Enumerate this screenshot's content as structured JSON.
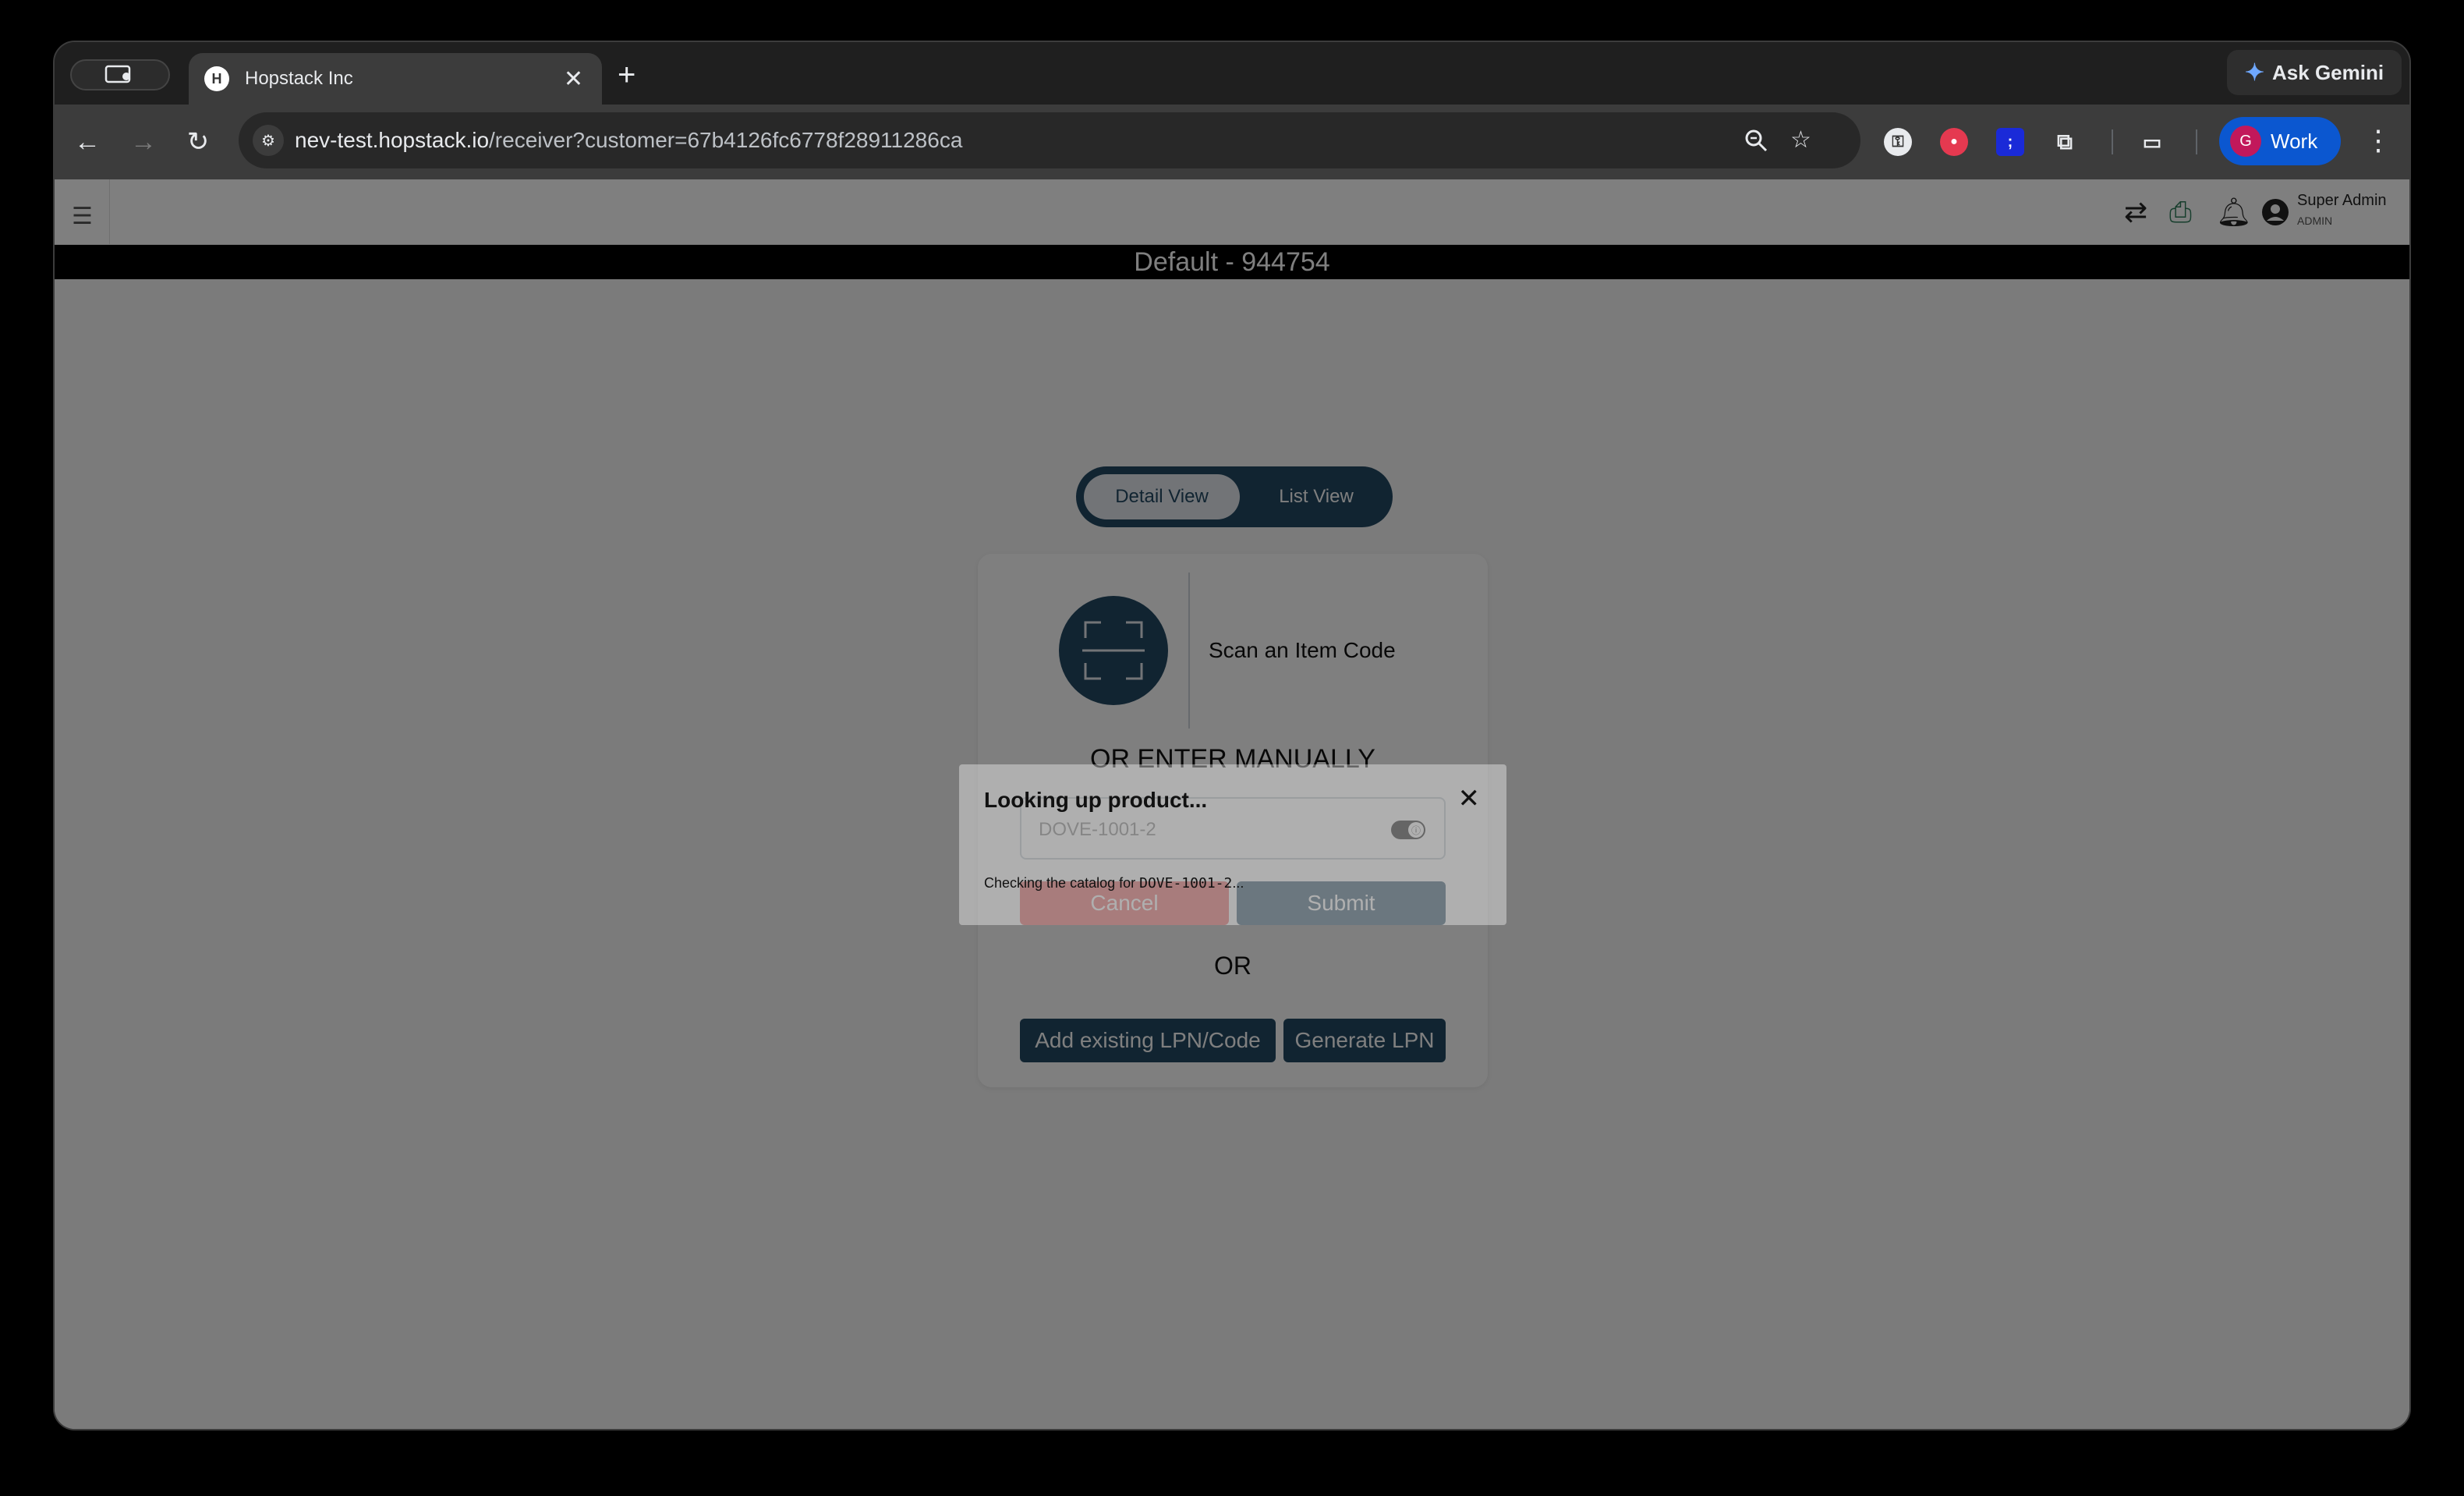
{
  "browser": {
    "tab": {
      "title": "Hopstack Inc",
      "favicon_letter": "H",
      "close_glyph": "✕"
    },
    "new_tab_glyph": "+",
    "ask_gemini_label": "Ask Gemini",
    "url_host": "nev-test.hopstack.io",
    "url_path": "/receiver?customer=67b4126fc6778f28911286ca",
    "profile": {
      "initial": "G",
      "label": "Work",
      "avatar_color": "#c2185b"
    },
    "icons": [
      "tab-search-icon",
      "back-icon",
      "forward-icon",
      "reload-icon",
      "site-info-icon",
      "zoom-icon",
      "bookmark-star-icon",
      "password-manager-icon",
      "extension-red-icon",
      "extension-blue-icon",
      "extensions-puzzle-icon",
      "tab-capture-icon",
      "menu-kebab-icon"
    ]
  },
  "app": {
    "user": {
      "name": "Super Admin",
      "role": "ADMIN"
    },
    "banner": "Default - 944754",
    "view_toggle": {
      "active": "Detail View",
      "inactive": "List View"
    },
    "scan": {
      "prompt": "Scan an Item Code"
    },
    "manual": {
      "heading": "OR ENTER MANUALLY",
      "input_value": "DOVE-1001-2",
      "cancel_label": "Cancel",
      "submit_label": "Submit"
    },
    "or_label": "OR",
    "add_lpn_label": "Add existing LPN/Code",
    "generate_lpn_label": "Generate LPN"
  },
  "dialog": {
    "title": "Looking up product...",
    "message_prefix": "Checking the catalog for ",
    "message_code": "DOVE-1001-2",
    "message_suffix": "...",
    "close_glyph": "✕"
  },
  "colors": {
    "brand_navy": "#224863",
    "cancel_red": "#e65a5a",
    "profile_blue": "#0b57d0",
    "print_green": "#2e7d5b"
  }
}
